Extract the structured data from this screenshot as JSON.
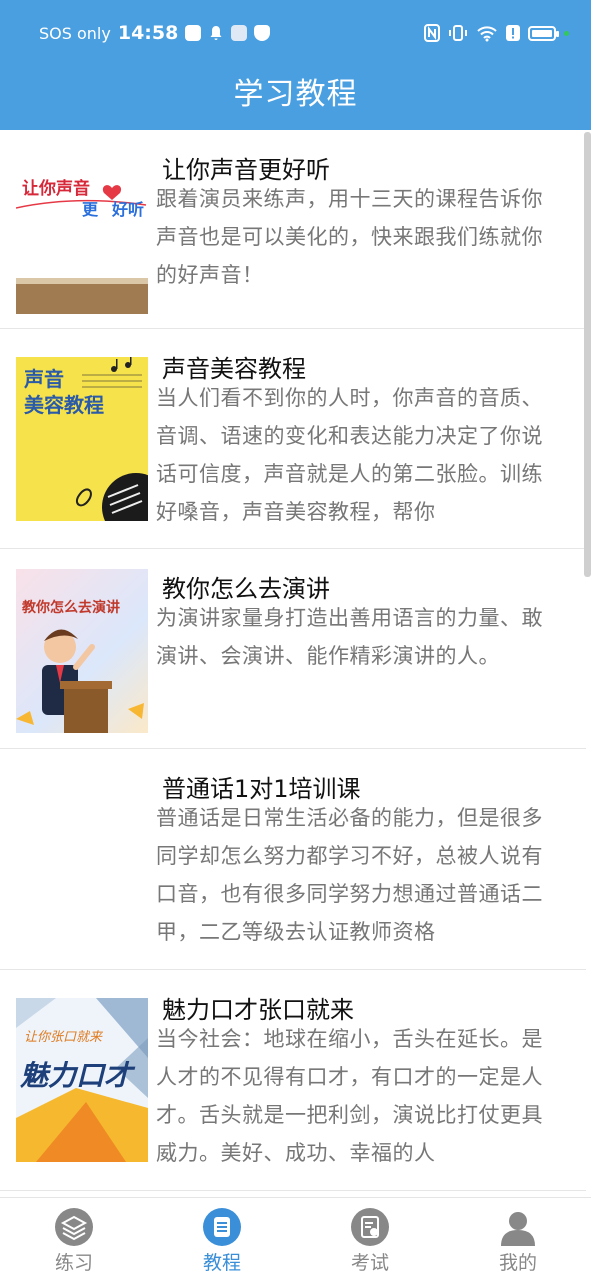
{
  "status": {
    "carrier": "SOS only",
    "time": "14:58",
    "battery_level": 0.85
  },
  "header": {
    "title": "学习教程"
  },
  "courses": [
    {
      "title": "让你声音更好听",
      "desc": "跟着演员来练声，用十三天的课程告诉你声音也是可以美化的，快来跟我们练就你的好声音！",
      "thumb_text": [
        "让你声音",
        "更",
        "好听"
      ]
    },
    {
      "title": "声音美容教程",
      "desc": "当人们看不到你的人时，你声音的音质、音调、语速的变化和表达能力决定了你说话可信度，声音就是人的第二张脸。训练好嗓音，声音美容教程，帮你",
      "thumb_text": [
        "声音",
        "美容教程"
      ]
    },
    {
      "title": "教你怎么去演讲",
      "desc": "为演讲家量身打造出善用语言的力量、敢演讲、会演讲、能作精彩演讲的人。",
      "thumb_text": [
        "教你怎么去演讲"
      ]
    },
    {
      "title": "普通话1对1培训课",
      "desc": "普通话是日常生活必备的能力，但是很多同学却怎么努力都学习不好，总被人说有口音，也有很多同学努力想通过普通话二甲，二乙等级去认证教师资格",
      "thumb_text": []
    },
    {
      "title": "魅力口才张口就来",
      "desc": "当今社会：地球在缩小，舌头在延长。是人才的不见得有口才，有口才的一定是人才。舌头就是一把利剑，演说比打仗更具威力。美好、成功、幸福的人",
      "thumb_text": [
        "让你张口就来",
        "魅力口才"
      ]
    }
  ],
  "tabs": [
    {
      "label": "练习",
      "icon": "layers-icon",
      "active": false
    },
    {
      "label": "教程",
      "icon": "document-icon",
      "active": true
    },
    {
      "label": "考试",
      "icon": "exam-icon",
      "active": false
    },
    {
      "label": "我的",
      "icon": "user-icon",
      "active": false
    }
  ],
  "colors": {
    "primary": "#4a9fe0",
    "active_tab": "#3a8fd8",
    "inactive": "#888888"
  }
}
